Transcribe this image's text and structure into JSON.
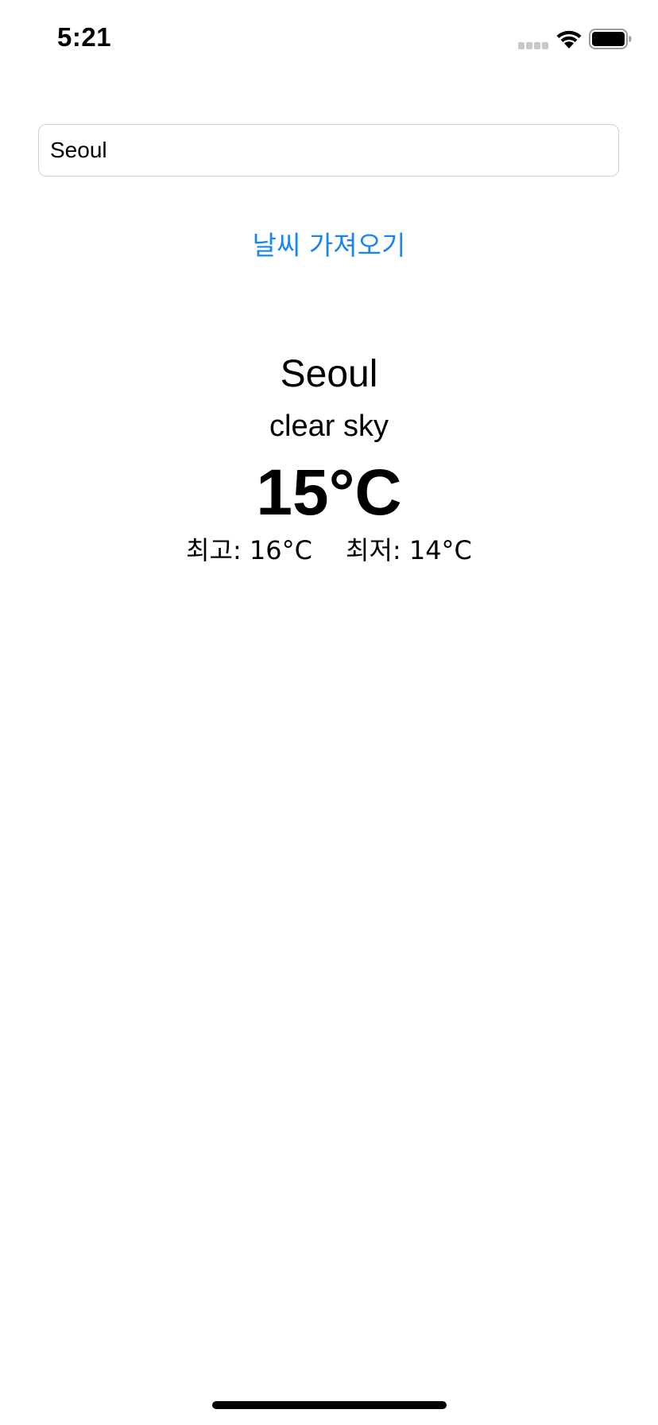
{
  "status_bar": {
    "time": "5:21",
    "icons": [
      "cellular-signal-icon",
      "wifi-icon",
      "battery-icon"
    ]
  },
  "search": {
    "value": "Seoul",
    "placeholder": ""
  },
  "fetch_button": {
    "label": "날씨 가져오기"
  },
  "weather": {
    "city": "Seoul",
    "description": "clear sky",
    "temperature": "15°C",
    "high": "최고: 16°C",
    "low": "최저: 14°C"
  },
  "colors": {
    "accent": "#1a84f0",
    "text": "#000000",
    "background": "#ffffff",
    "input_border": "#cfcfd4"
  }
}
